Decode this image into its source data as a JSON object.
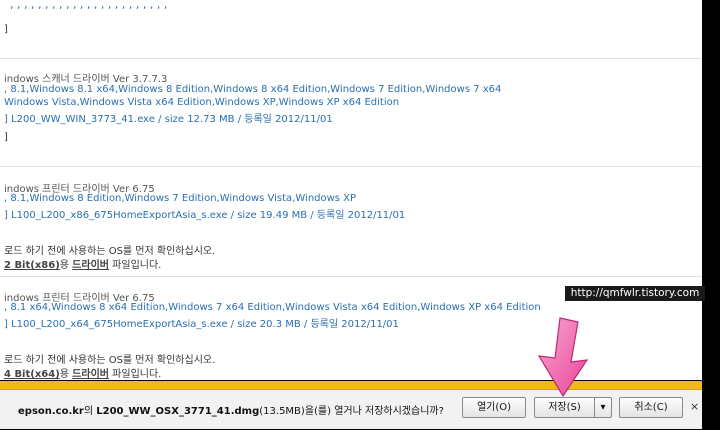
{
  "top_fragment": ", , , , , , , , , , , , , , , , , , , , , , ,",
  "sections": [
    {
      "bracket": "]",
      "title": "indows 스캐너 드라이버 Ver 3.7.7.3",
      "os_line1": ", 8.1,Windows 8.1 x64,Windows 8 Edition,Windows 8 x64 Edition,Windows 7 Edition,Windows 7 x64",
      "os_line2": "Windows Vista,Windows Vista x64 Edition,Windows XP,Windows XP x64 Edition",
      "file": "L200_WW_WIN_3773_41.exe",
      "size": "12.73 MB",
      "reg_label": "등록일",
      "date": "2012/11/01",
      "bracket2": "]"
    },
    {
      "title": "indows 프린터 드라이버 Ver 6.75",
      "os_line1": ", 8.1,Windows 8 Edition,Windows 7 Edition,Windows Vista,Windows XP",
      "file": "L100_L200_x86_675HomeExportAsia_s.exe",
      "size": "19.49 MB",
      "reg_label": "등록일",
      "date": "2012/11/01",
      "note1": "로드 하기 전에 사용하는 OS를 먼저 확인하십시오.",
      "note2_bold1": "2 Bit(x86)",
      "note2_mid": "용 ",
      "note2_bold2": "드라이버",
      "note2_end": " 파일입니다."
    },
    {
      "title": "indows 프린터 드라이버 Ver 6.75",
      "os_line1": ", 8.1 x64,Windows 8 x64 Edition,Windows 7 x64 Edition,Windows Vista x64 Edition,Windows XP x64 Edition",
      "file": "L100_L200_x64_675HomeExportAsia_s.exe",
      "size": "20.3 MB",
      "reg_label": "등록일",
      "date": "2012/11/01",
      "note1": "로드 하기 전에 사용하는 OS를 먼저 확인하십시오.",
      "note2_bold1": "4 Bit(x64)",
      "note2_mid": "용 ",
      "note2_bold2": "드라이버",
      "note2_end": " 파일입니다."
    }
  ],
  "watermark": "http://qmfwlr.tistory.com",
  "download_bar": {
    "site": "epson.co.kr",
    "site_suffix": "의 ",
    "filename": "L200_WW_OSX_3771_41.dmg",
    "size_text": "(13.5MB)",
    "message": "을(를) 열거나 저장하시겠습니까?",
    "open_label": "열기(O)",
    "save_label": "저장(S)",
    "save_dropdown": "▾",
    "cancel_label": "취소(C)",
    "close": "×",
    "stripe_color": "#f0b818"
  },
  "annotation": {
    "arrow_color": "#f06fae",
    "icon": "pink-arrow-icon"
  }
}
